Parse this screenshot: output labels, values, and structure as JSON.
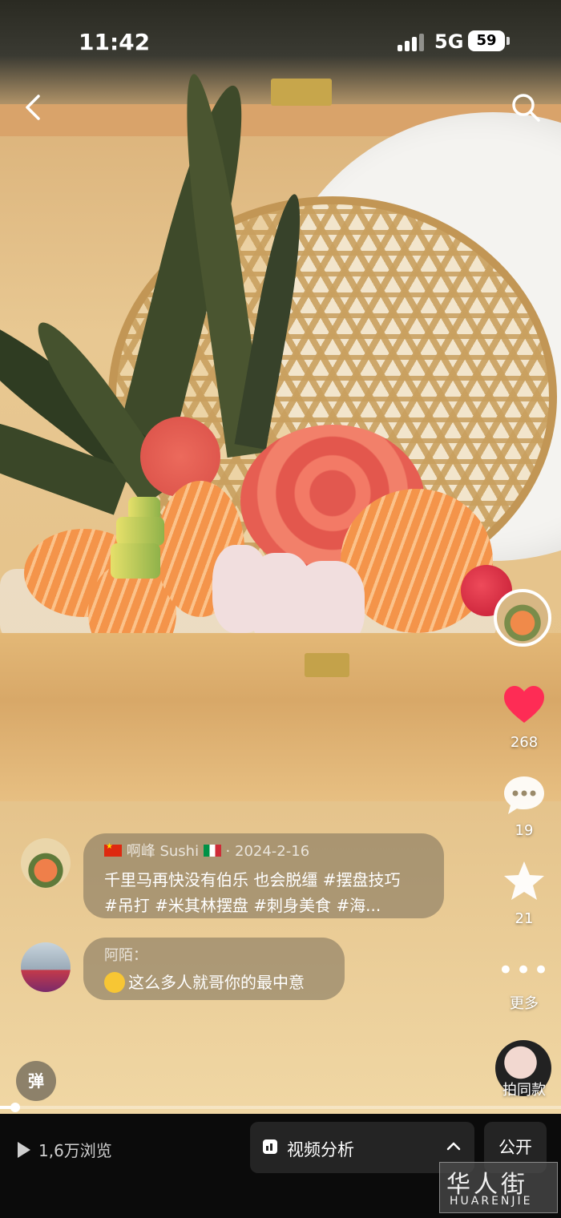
{
  "status_bar": {
    "time": "11:42",
    "network": "5G",
    "battery": "59"
  },
  "rail": {
    "likes": "268",
    "comments": "19",
    "favorites": "21",
    "more_label": "更多",
    "same_style_label": "拍同款"
  },
  "comments": [
    {
      "author": "啊峰 Sushi",
      "date": "· 2024-2-16",
      "line1": "千里马再快没有伯乐 也会脱缰 #摆盘技巧",
      "line2": "#吊打 #米其林摆盘 #刺身美食 #海..."
    },
    {
      "author": "阿陌：",
      "text": "这么多人就哥你的最中意"
    }
  ],
  "danmu_label": "弹",
  "progress": 0.027,
  "bottom_bar": {
    "views": "1,6万浏览",
    "analysis_label": "视频分析",
    "visibility_label": "公开"
  },
  "watermark": {
    "line1": "华人街",
    "line2": "HUARENJIE"
  },
  "colors": {
    "like": "#fe2c55",
    "bar_bg": "#0b0b0b",
    "button_bg": "#242424"
  }
}
